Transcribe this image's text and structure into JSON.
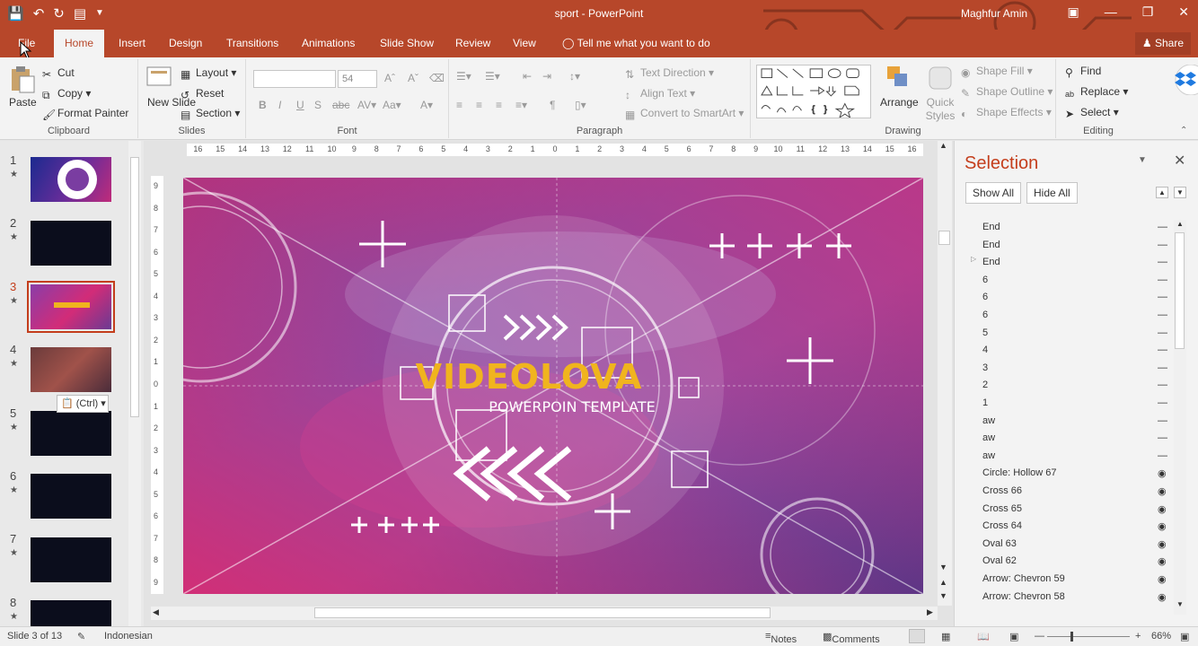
{
  "window": {
    "title": "sport  -  PowerPoint",
    "user": "Maghfur Amin"
  },
  "tabs": [
    {
      "label": "File"
    },
    {
      "label": "Home"
    },
    {
      "label": "Insert"
    },
    {
      "label": "Design"
    },
    {
      "label": "Transitions"
    },
    {
      "label": "Animations"
    },
    {
      "label": "Slide Show"
    },
    {
      "label": "Review"
    },
    {
      "label": "View"
    },
    {
      "label": "Tell me what you want to do"
    }
  ],
  "share_label": "Share",
  "ribbon": {
    "clipboard": {
      "label": "Clipboard",
      "paste": "Paste",
      "cut": "Cut",
      "copy": "Copy",
      "format_painter": "Format Painter"
    },
    "slides": {
      "label": "Slides",
      "new_slide": "New Slide",
      "layout": "Layout",
      "reset": "Reset",
      "section": "Section"
    },
    "font": {
      "label": "Font",
      "size": "54"
    },
    "paragraph": {
      "label": "Paragraph",
      "text_direction": "Text Direction",
      "align_text": "Align Text",
      "convert_smartart": "Convert to SmartArt"
    },
    "drawing": {
      "label": "Drawing",
      "arrange": "Arrange",
      "quick_styles": "Quick Styles",
      "shape_fill": "Shape Fill",
      "shape_outline": "Shape Outline",
      "shape_effects": "Shape Effects"
    },
    "editing": {
      "label": "Editing",
      "find": "Find",
      "replace": "Replace",
      "select": "Select"
    }
  },
  "thumbnails": [
    {
      "num": "1"
    },
    {
      "num": "2"
    },
    {
      "num": "3"
    },
    {
      "num": "4"
    },
    {
      "num": "5"
    },
    {
      "num": "6"
    },
    {
      "num": "7"
    },
    {
      "num": "8"
    }
  ],
  "paste_options": "(Ctrl)",
  "ruler_h": [
    "16",
    "15",
    "14",
    "13",
    "12",
    "11",
    "10",
    "9",
    "8",
    "7",
    "6",
    "5",
    "4",
    "3",
    "2",
    "1",
    "0",
    "1",
    "2",
    "3",
    "4",
    "5",
    "6",
    "7",
    "8",
    "9",
    "10",
    "11",
    "12",
    "13",
    "14",
    "15",
    "16"
  ],
  "ruler_v": [
    "9",
    "8",
    "7",
    "6",
    "5",
    "4",
    "3",
    "2",
    "1",
    "0",
    "1",
    "2",
    "3",
    "4",
    "5",
    "6",
    "7",
    "8",
    "9"
  ],
  "slide": {
    "title": "VIDEOLOVA",
    "subtitle": "POWERPOIN TEMPLATE"
  },
  "selection_pane": {
    "title": "Selection",
    "show_all": "Show All",
    "hide_all": "Hide All",
    "items": [
      {
        "name": "End",
        "visible": false
      },
      {
        "name": "End",
        "visible": false
      },
      {
        "name": "End",
        "visible": false
      },
      {
        "name": "6",
        "visible": false
      },
      {
        "name": "6",
        "visible": false
      },
      {
        "name": "6",
        "visible": false
      },
      {
        "name": "5",
        "visible": false
      },
      {
        "name": "4",
        "visible": false
      },
      {
        "name": "3",
        "visible": false
      },
      {
        "name": "2",
        "visible": false
      },
      {
        "name": "1",
        "visible": false
      },
      {
        "name": "aw",
        "visible": false
      },
      {
        "name": "aw",
        "visible": false
      },
      {
        "name": "aw",
        "visible": false
      },
      {
        "name": "Circle: Hollow 67",
        "visible": true
      },
      {
        "name": "Cross 66",
        "visible": true
      },
      {
        "name": "Cross 65",
        "visible": true
      },
      {
        "name": "Cross 64",
        "visible": true
      },
      {
        "name": "Oval 63",
        "visible": true
      },
      {
        "name": "Oval 62",
        "visible": true
      },
      {
        "name": "Arrow: Chevron 59",
        "visible": true
      },
      {
        "name": "Arrow: Chevron 58",
        "visible": true
      }
    ]
  },
  "status": {
    "slide_info": "Slide 3 of 13",
    "language": "Indonesian",
    "notes": "Notes",
    "comments": "Comments",
    "zoom": "66%"
  },
  "colors": {
    "accent": "#b7472a",
    "active_accent": "#c43e1c",
    "slide_gradient_start": "#d22c78",
    "slide_gradient_end": "#6a3a93",
    "title_color": "#f0b41e"
  }
}
